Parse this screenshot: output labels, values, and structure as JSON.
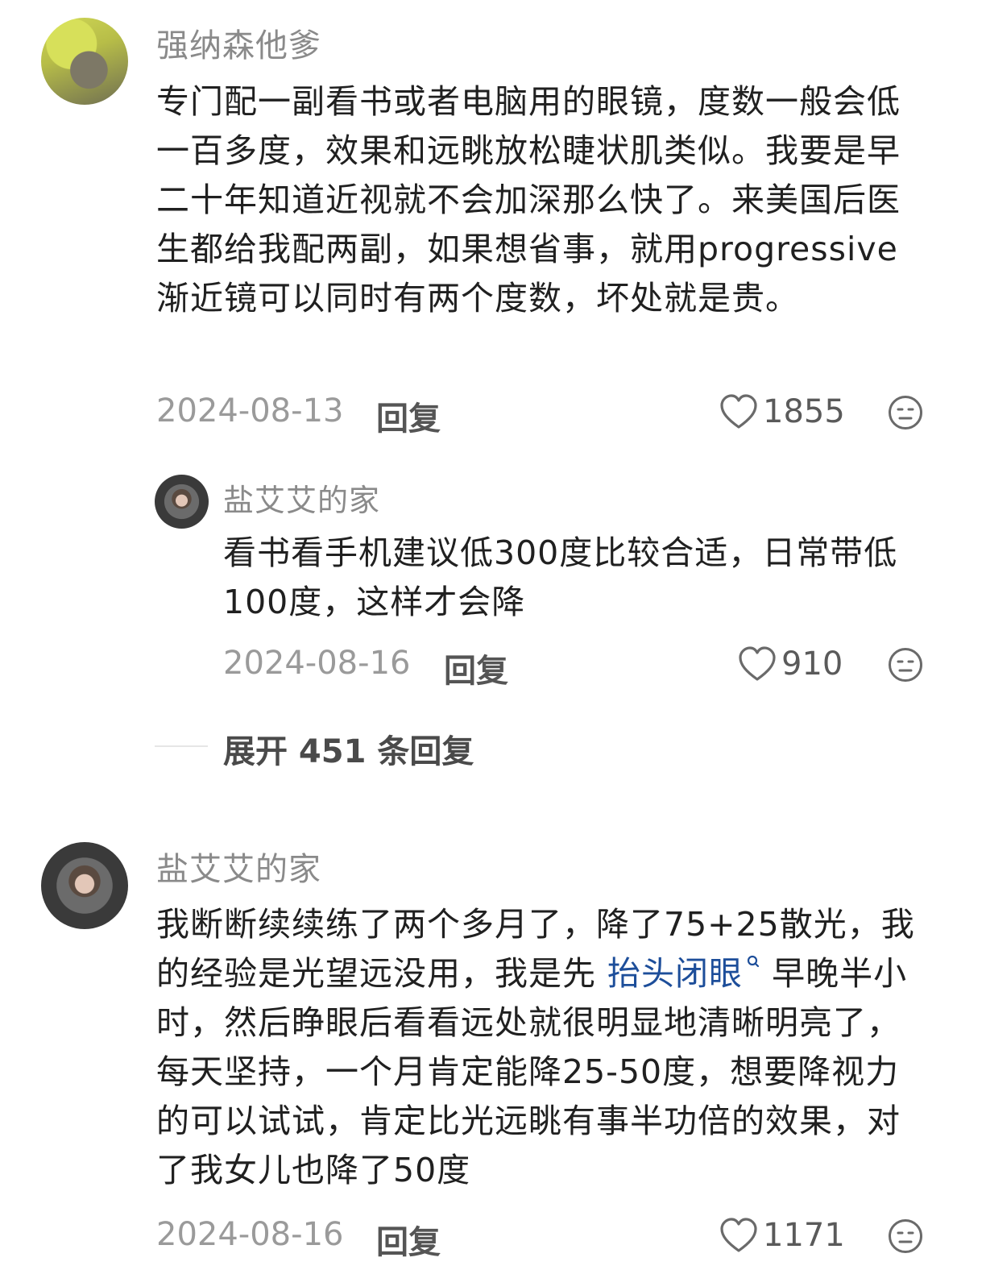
{
  "comments": [
    {
      "username": "强纳森他爹",
      "text": "专门配一副看书或者电脑用的眼镜，度数一般会低一百多度，效果和远眺放松睫状肌类似。我要是早二十年知道近视就不会加深那么快了。来美国后医生都给我配两副，如果想省事，就用progressive渐近镜可以同时有两个度数，坏处就是贵。",
      "date": "2024-08-13",
      "reply_label": "回复",
      "likes": "1855",
      "reply": {
        "username": "盐艾艾的家",
        "text": "看书看手机建议低300度比较合适，日常带低100度，这样才会降",
        "date": "2024-08-16",
        "reply_label": "回复",
        "likes": "910"
      },
      "expand_label": "展开 451 条回复"
    },
    {
      "username": "盐艾艾的家",
      "text_before_link": "我断断续续练了两个多月了，降了75+25散光，我的经验是光望远没用，我是先 ",
      "link_text": "抬头闭眼",
      "text_after_link": " 早晚半小时，然后睁眼后看看远处就很明显地清晰明亮了，每天坚持，一个月肯定能降25-50度，想要降视力的可以试试，肯定比光远眺有事半功倍的效果，对了我女儿也降了50度",
      "date": "2024-08-16",
      "reply_label": "回复",
      "likes": "1171"
    }
  ],
  "colors": {
    "text": "#202020",
    "muted": "#8a8a8a",
    "link": "#1d4e9a"
  },
  "icons": {
    "like": "heart-outline-icon",
    "dislike": "neutral-face-icon",
    "search_suffix": "search-icon"
  }
}
